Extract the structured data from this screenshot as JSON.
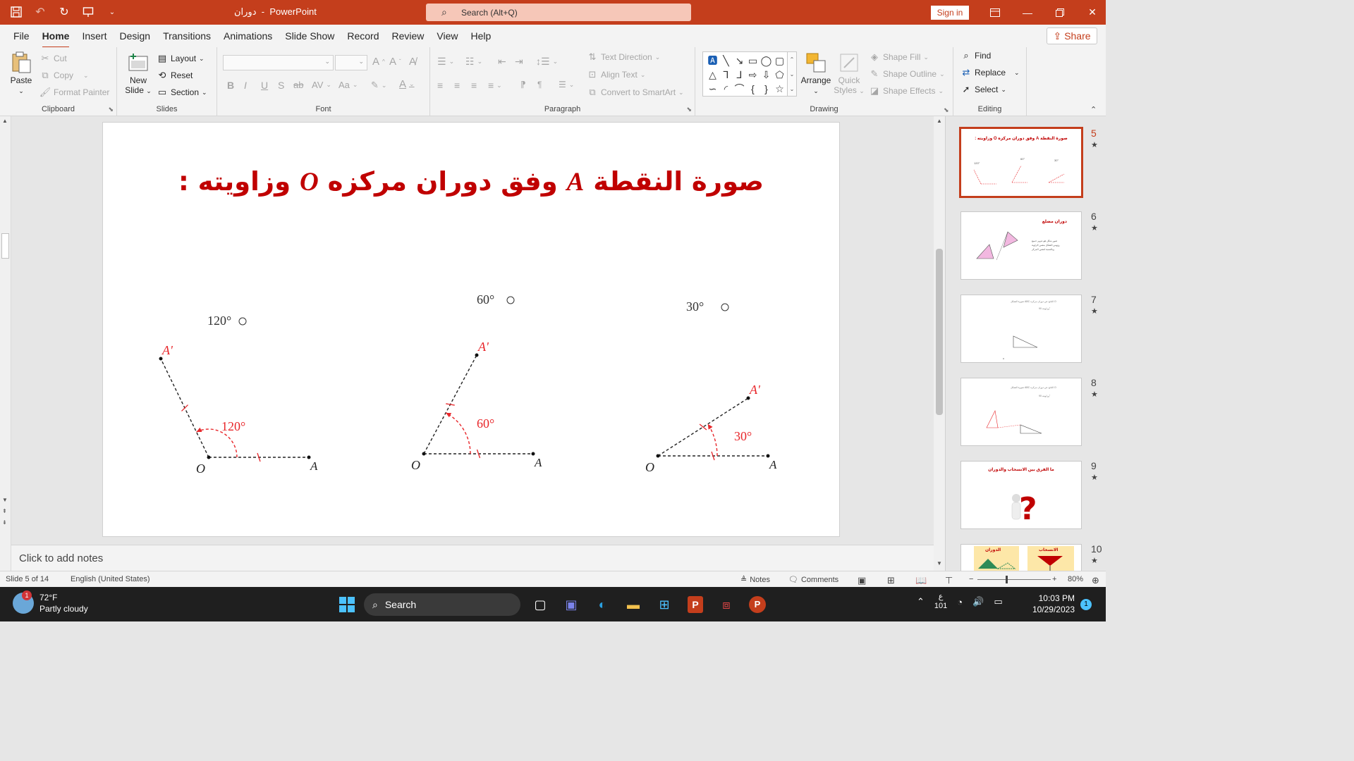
{
  "titlebar": {
    "doc_name": "دوران",
    "separator": "-",
    "app_name": "PowerPoint",
    "search_placeholder": "Search (Alt+Q)",
    "signin_label": "Sign in"
  },
  "menu": {
    "tabs": [
      "File",
      "Home",
      "Insert",
      "Design",
      "Transitions",
      "Animations",
      "Slide Show",
      "Record",
      "Review",
      "View",
      "Help"
    ],
    "active_tab": "Home",
    "share_label": "Share"
  },
  "ribbon": {
    "clipboard": {
      "paste": "Paste",
      "cut": "Cut",
      "copy": "Copy",
      "format_painter": "Format Painter",
      "label": "Clipboard"
    },
    "slides": {
      "new_slide_line1": "New",
      "new_slide_line2": "Slide",
      "layout": "Layout",
      "reset": "Reset",
      "section": "Section",
      "label": "Slides"
    },
    "font": {
      "label": "Font"
    },
    "paragraph": {
      "text_direction": "Text Direction",
      "align_text": "Align Text",
      "convert_smartart": "Convert to SmartArt",
      "label": "Paragraph"
    },
    "drawing": {
      "arrange": "Arrange",
      "quick_styles_line1": "Quick",
      "quick_styles_line2": "Styles",
      "shape_fill": "Shape Fill",
      "shape_outline": "Shape Outline",
      "shape_effects": "Shape Effects",
      "label": "Drawing"
    },
    "editing": {
      "find": "Find",
      "replace": "Replace",
      "select": "Select",
      "label": "Editing"
    }
  },
  "slide": {
    "title_text": "صورة النقطة",
    "title_var_a": "A",
    "title_mid": "وفق دوران مركزه",
    "title_var_o": "O",
    "title_end": "وزاويته :",
    "figures": [
      {
        "heading": "120°",
        "angle_label": "120°",
        "point_o": "O",
        "point_a": "A",
        "point_a_prime": "A'"
      },
      {
        "heading": "60°",
        "angle_label": "60°",
        "point_o": "O",
        "point_a": "A",
        "point_a_prime": "A'"
      },
      {
        "heading": "30°",
        "angle_label": "30°",
        "point_o": "O",
        "point_a": "A",
        "point_a_prime": "A'"
      }
    ]
  },
  "notes_placeholder": "Click to add notes",
  "thumbnails": [
    {
      "num": "5",
      "title": "صورة النقطة A وفق دوران مركزه O وزاويته :"
    },
    {
      "num": "6",
      "title": "دوران مضلع"
    },
    {
      "num": "7",
      "title": ""
    },
    {
      "num": "8",
      "title": ""
    },
    {
      "num": "9",
      "title": "ما الفرق بين الانسحاب والدوران"
    },
    {
      "num": "10",
      "title_left": "الدوران",
      "title_right": "الانسحاب"
    }
  ],
  "status": {
    "slide_count": "Slide 5 of 14",
    "language": "English (United States)",
    "notes": "Notes",
    "comments": "Comments",
    "zoom": "80%"
  },
  "taskbar": {
    "temp": "72°F",
    "weather": "Partly cloudy",
    "weather_badge": "1",
    "search": "Search",
    "lang_line1": "ع",
    "lang_line2": "101",
    "time": "10:03 PM",
    "date": "10/29/2023",
    "notif_count": "1"
  },
  "colors": {
    "accent": "#c43e1c",
    "title_red": "#c00000",
    "figure_red": "#e8262a"
  }
}
